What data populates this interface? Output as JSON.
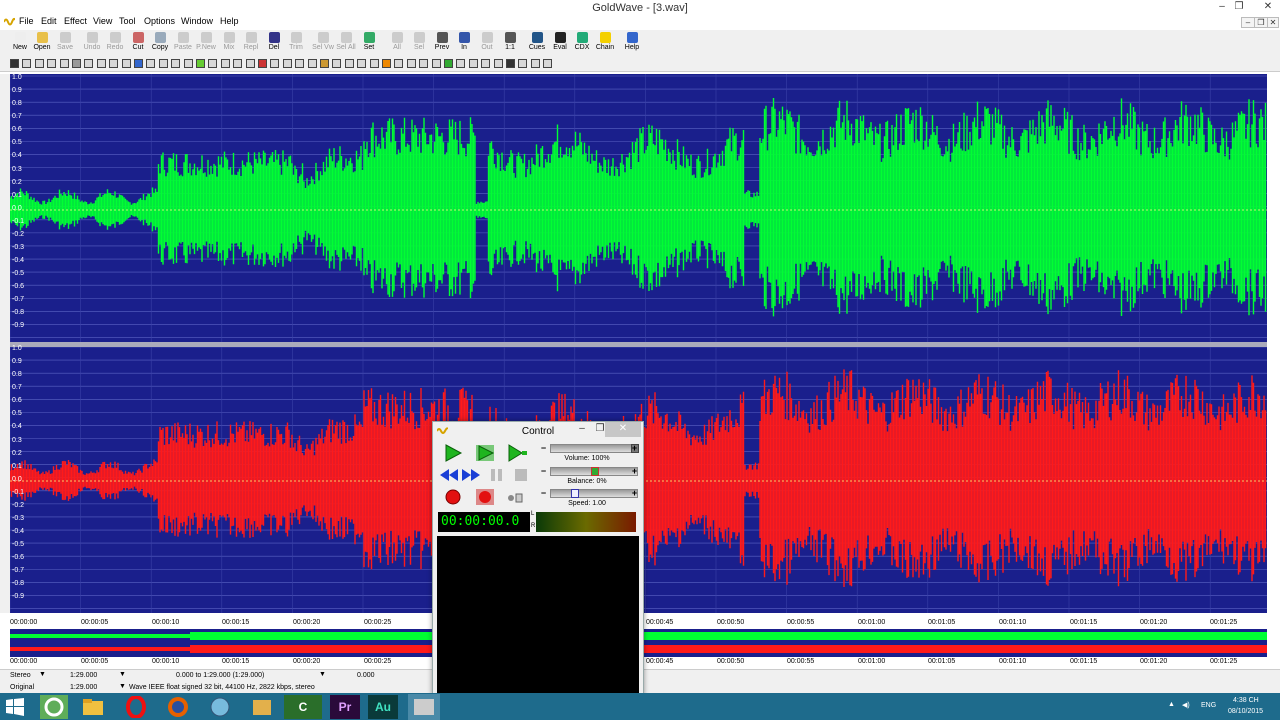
{
  "window": {
    "title": "GoldWave - [3.wav]",
    "minimize": "–",
    "restore": "❐",
    "close": "✕"
  },
  "menu": [
    "File",
    "Edit",
    "Effect",
    "View",
    "Tool",
    "Options",
    "Window",
    "Help"
  ],
  "toolbar": [
    {
      "label": "New",
      "icon": "new-icon",
      "enabled": true
    },
    {
      "label": "Open",
      "icon": "open-icon",
      "enabled": true
    },
    {
      "label": "Save",
      "icon": "save-icon",
      "enabled": false
    },
    {
      "label": "Undo",
      "icon": "undo-icon",
      "enabled": false
    },
    {
      "label": "Redo",
      "icon": "redo-icon",
      "enabled": false
    },
    {
      "label": "Cut",
      "icon": "cut-icon",
      "enabled": true
    },
    {
      "label": "Copy",
      "icon": "copy-icon",
      "enabled": true
    },
    {
      "label": "Paste",
      "icon": "paste-icon",
      "enabled": false
    },
    {
      "label": "P.New",
      "icon": "paste-new-icon",
      "enabled": false
    },
    {
      "label": "Mix",
      "icon": "mix-icon",
      "enabled": false
    },
    {
      "label": "Repl",
      "icon": "replace-icon",
      "enabled": false
    },
    {
      "label": "Del",
      "icon": "delete-icon",
      "enabled": true
    },
    {
      "label": "Trim",
      "icon": "trim-icon",
      "enabled": false
    },
    {
      "label": "Sel Vw",
      "icon": "select-view-icon",
      "enabled": false
    },
    {
      "label": "Sel All",
      "icon": "select-all-icon",
      "enabled": false
    },
    {
      "label": "Set",
      "icon": "set-icon",
      "enabled": true
    },
    {
      "label": "All",
      "icon": "zoom-all-icon",
      "enabled": false
    },
    {
      "label": "Sel",
      "icon": "zoom-select-icon",
      "enabled": false
    },
    {
      "label": "Prev",
      "icon": "zoom-prev-icon",
      "enabled": true
    },
    {
      "label": "In",
      "icon": "zoom-in-icon",
      "enabled": true
    },
    {
      "label": "Out",
      "icon": "zoom-out-icon",
      "enabled": false
    },
    {
      "label": "1:1",
      "icon": "zoom-1-1-icon",
      "enabled": true
    },
    {
      "label": "Cues",
      "icon": "cues-icon",
      "enabled": true
    },
    {
      "label": "Eval",
      "icon": "eval-icon",
      "enabled": true
    },
    {
      "label": "CDX",
      "icon": "cdx-icon",
      "enabled": true
    },
    {
      "label": "Chain",
      "icon": "chain-icon",
      "enabled": true
    },
    {
      "label": "Help",
      "icon": "help-icon",
      "enabled": true
    }
  ],
  "scale_labels": [
    "1.0",
    "0.9",
    "0.8",
    "0.7",
    "0.6",
    "0.5",
    "0.4",
    "0.3",
    "0.2",
    "0.1",
    "0.0",
    "-0.1",
    "-0.2",
    "-0.3",
    "-0.4",
    "-0.5",
    "-0.6",
    "-0.7",
    "-0.8",
    "-0.9"
  ],
  "ruler_labels": [
    "00:00:00",
    "00:00:05",
    "00:00:10",
    "00:00:15",
    "00:00:20",
    "00:00:25",
    "00:00:45",
    "00:00:50",
    "00:00:55",
    "00:01:00",
    "00:01:05",
    "00:01:10",
    "00:01:15",
    "00:01:20",
    "00:01:25"
  ],
  "status": {
    "channel": "Stereo",
    "length": "1:29.000",
    "selection": "0.000 to 1:29.000 (1:29.000)",
    "position": "0.000",
    "original_label": "Original",
    "original_length": "1:29.000",
    "format": "Wave IEEE float signed 32 bit, 44100 Hz, 2822 kbps, stereo"
  },
  "control": {
    "title": "Control",
    "volume": "Volume: 100%",
    "balance": "Balance: 0%",
    "speed": "Speed: 1.00",
    "time": "00:00:00.0",
    "meter_left": "L",
    "meter_right": "R",
    "volume_level": 1.0,
    "balance_level": 0.5,
    "speed_level": 0.25
  },
  "taskbar": {
    "apps": [
      "windows-start-icon",
      "chrome-icon",
      "file-explorer-icon",
      "opera-icon",
      "firefox-icon",
      "network-icon",
      "folder-icon",
      "camtasia-icon",
      "premiere-icon",
      "audition-icon",
      "goldwave-icon"
    ],
    "premiere_label": "Pr",
    "audition_label": "Au",
    "camtasia_label": "C",
    "lang": "ENG",
    "time": "4:38 CH",
    "date": "08/10/2015"
  },
  "colors": {
    "wave_background": "#1a1f8c",
    "left_channel": "#00ff33",
    "right_channel": "#ff1a1a",
    "taskbar": "#1e6b8c"
  }
}
